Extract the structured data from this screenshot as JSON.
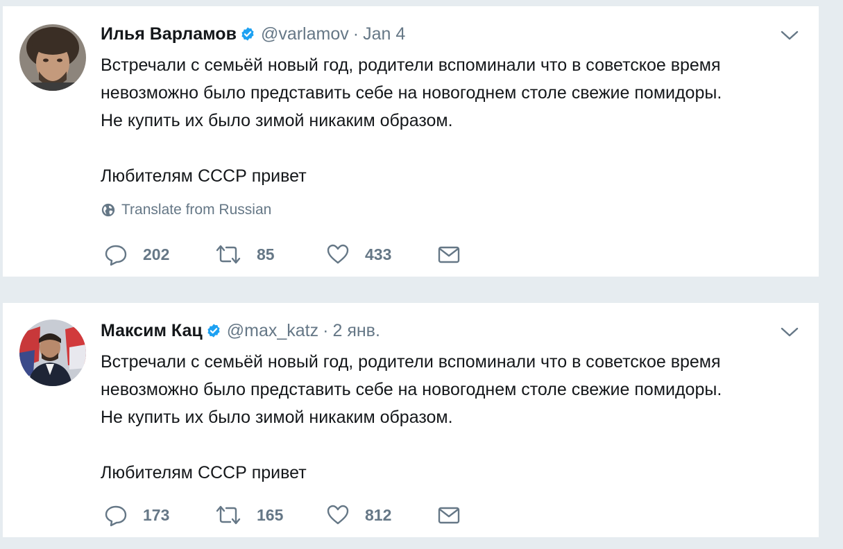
{
  "tweets": [
    {
      "author_name": "Илья Варламов",
      "handle": "@varlamov",
      "separator": "·",
      "date": "Jan 4",
      "text_lines": [
        "Встречали с семьёй новый год, родители вспоминали что в советское время",
        "невозможно было представить себе на новогоднем столе свежие помидоры.",
        "Не купить их было зимой никаким образом."
      ],
      "text_last": "Любителям СССР привет",
      "translate_label": "Translate from Russian",
      "replies": "202",
      "retweets": "85",
      "likes": "433"
    },
    {
      "author_name": "Максим Кац",
      "handle": "@max_katz",
      "separator": "·",
      "date": "2 янв.",
      "text_lines": [
        "Встречали с семьёй новый год, родители вспоминали что в советское время",
        "невозможно было представить себе на новогоднем столе свежие помидоры.",
        "Не купить их было зимой никаким образом."
      ],
      "text_last": "Любителям СССР привет",
      "replies": "173",
      "retweets": "165",
      "likes": "812"
    }
  ],
  "icons": {
    "verified": "verified-badge-icon",
    "caret": "chevron-down-icon",
    "globe": "globe-icon",
    "reply": "reply-icon",
    "retweet": "retweet-icon",
    "like": "heart-icon",
    "dm": "envelope-icon"
  },
  "colors": {
    "verified_blue": "#1da1f2",
    "secondary_text": "#657786",
    "background": "#e6ecf0"
  }
}
